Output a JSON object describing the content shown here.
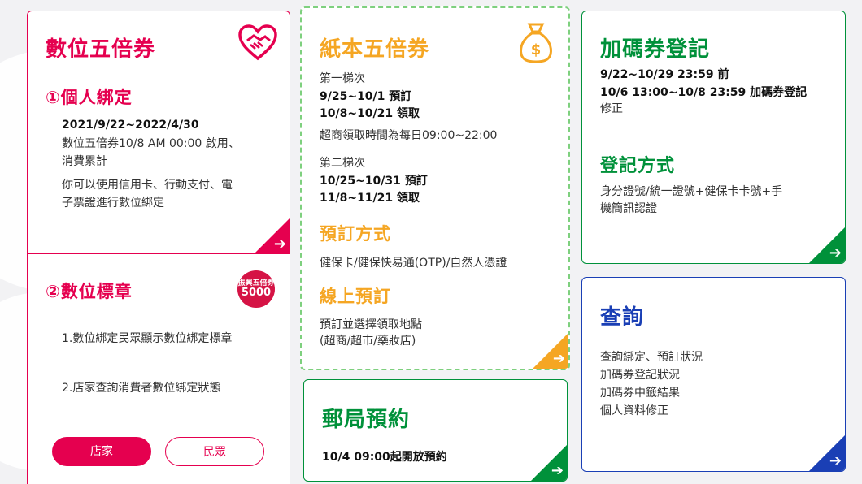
{
  "digital": {
    "title": "數位五倍券",
    "personal": {
      "heading": "①個人綁定",
      "dates": "2021/9/22~2022/4/30",
      "line1": "數位五倍券10/8 AM 00:00 啟用、",
      "line2": "消費累計",
      "line3": "你可以使用信用卡、行動支付、電",
      "line4": "子票證進行數位綁定"
    },
    "badge": {
      "heading": "②數位標章",
      "icon_top": "振興五倍券",
      "icon_big": "5000",
      "item1": "1.數位綁定民眾顯示數位綁定標章",
      "item2": "2.店家查詢消費者數位綁定狀態",
      "store_button": "店家",
      "public_button": "民眾"
    }
  },
  "paper": {
    "title": "紙本五倍券",
    "batch1_label": "第一梯次",
    "batch1_order": "9/25~10/1 預訂",
    "batch1_pickup": "10/8~10/21 領取",
    "store_hours": "超商領取時間為每日09:00~22:00",
    "batch2_label": "第二梯次",
    "batch2_order": "10/25~10/31 預訂",
    "batch2_pickup": "11/8~11/21 領取",
    "method_heading": "預訂方式",
    "method_text": "健保卡/健保快易通(OTP)/自然人憑證",
    "online_heading": "線上預訂",
    "online_line1": "預訂並選擇領取地點",
    "online_line2": "(超商/超市/藥妝店)"
  },
  "post": {
    "title": "郵局預約",
    "text": "10/4 09:00起開放預約"
  },
  "bonus": {
    "title": "加碼券登記",
    "line1": "9/22~10/29 23:59 前",
    "line2": "10/6 13:00~10/8 23:59 加碼券登記",
    "line3": "修正",
    "method_heading": "登記方式",
    "method_line1": "身分證號/統一證號+健保卡卡號+手",
    "method_line2": "機簡訊認證"
  },
  "query": {
    "title": "查詢",
    "item1": "查詢綁定、預訂狀況",
    "item2": "加碼券登記狀況",
    "item3": "加碼券中籤結果",
    "item4": "個人資料修正"
  },
  "icons": {
    "heart": "heart-handshake-icon",
    "money_bag": "money-bag-icon",
    "badge": "stimulus-badge-icon",
    "arrow": "arrow-right-icon"
  },
  "colors": {
    "red": "#e5004f",
    "orange": "#f5a623",
    "green": "#00913a",
    "blue": "#1a3fb5",
    "dashed_border": "#7ed07e"
  }
}
